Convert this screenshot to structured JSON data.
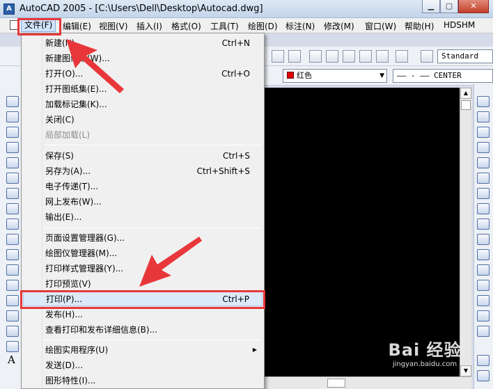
{
  "window": {
    "title": "AutoCAD 2005 - [C:\\Users\\Dell\\Desktop\\Autocad.dwg]",
    "icons": [
      "app-icon",
      "minimize-icon",
      "maximize-icon",
      "close-icon"
    ]
  },
  "menubar": {
    "items": [
      "文件(F)",
      "编辑(E)",
      "视图(V)",
      "插入(I)",
      "格式(O)",
      "工具(T)",
      "绘图(D)",
      "标注(N)",
      "修改(M)",
      "窗口(W)",
      "帮助(H)",
      "HDSHM"
    ],
    "active_index": 0
  },
  "toolbars": {
    "text_style": "Standard",
    "layer_color": "红色",
    "linetype": "CENTER",
    "color_swatch": "#e00000"
  },
  "file_menu": {
    "items": [
      {
        "label": "新建(N)...",
        "shortcut": "Ctrl+N",
        "disabled": false
      },
      {
        "label": "新建图纸集(W)...",
        "shortcut": "",
        "disabled": false
      },
      {
        "label": "打开(O)...",
        "shortcut": "Ctrl+O",
        "disabled": false
      },
      {
        "label": "打开图纸集(E)...",
        "shortcut": "",
        "disabled": false
      },
      {
        "label": "加载标记集(K)...",
        "shortcut": "",
        "disabled": false
      },
      {
        "label": "关闭(C)",
        "shortcut": "",
        "disabled": false
      },
      {
        "label": "局部加载(L)",
        "shortcut": "",
        "disabled": true
      },
      {
        "label": "保存(S)",
        "shortcut": "Ctrl+S",
        "disabled": false
      },
      {
        "label": "另存为(A)...",
        "shortcut": "Ctrl+Shift+S",
        "disabled": false
      },
      {
        "label": "电子传递(T)...",
        "shortcut": "",
        "disabled": false
      },
      {
        "label": "网上发布(W)...",
        "shortcut": "",
        "disabled": false
      },
      {
        "label": "输出(E)...",
        "shortcut": "",
        "disabled": false
      },
      {
        "label": "页面设置管理器(G)...",
        "shortcut": "",
        "disabled": false
      },
      {
        "label": "绘图仪管理器(M)...",
        "shortcut": "",
        "disabled": false
      },
      {
        "label": "打印样式管理器(Y)...",
        "shortcut": "",
        "disabled": false
      },
      {
        "label": "打印预览(V)",
        "shortcut": "",
        "disabled": false
      },
      {
        "label": "打印(P)...",
        "shortcut": "Ctrl+P",
        "disabled": false
      },
      {
        "label": "发布(H)...",
        "shortcut": "",
        "disabled": false
      },
      {
        "label": "查看打印和发布详细信息(B)...",
        "shortcut": "",
        "disabled": false
      },
      {
        "label": "绘图实用程序(U)",
        "shortcut": "",
        "disabled": false
      },
      {
        "label": "发送(D)...",
        "shortcut": "",
        "disabled": false
      },
      {
        "label": "图形特性(I)...",
        "shortcut": "",
        "disabled": false
      }
    ],
    "highlighted_index": 16
  },
  "watermark": {
    "logo": "Bai 经验",
    "sub": "jingyan.baidu.com"
  },
  "annotation_color": "#e8373a"
}
